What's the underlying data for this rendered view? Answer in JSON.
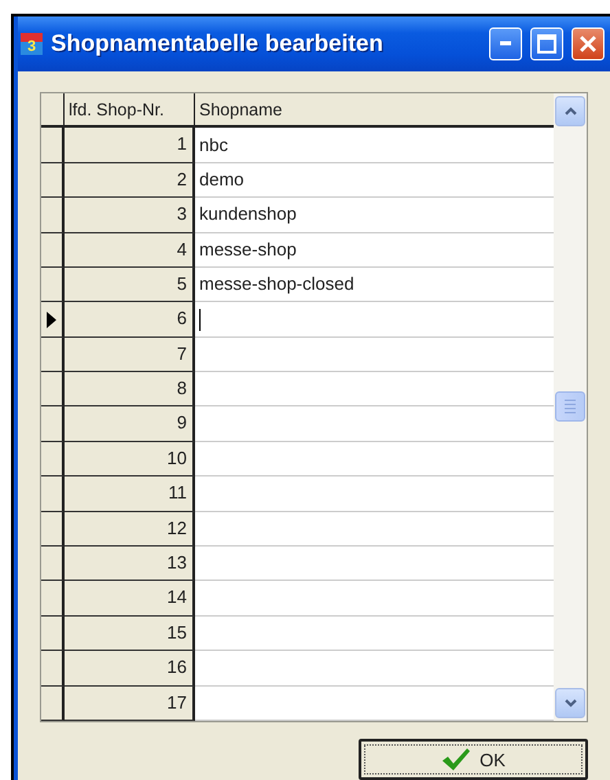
{
  "window": {
    "title": "Shopnamentabelle bearbeiten",
    "app_icon": "3"
  },
  "table": {
    "columns": [
      "lfd. Shop-Nr.",
      "Shopname"
    ],
    "rows": [
      {
        "number": "1",
        "name": "nbc",
        "selected": false
      },
      {
        "number": "2",
        "name": "demo",
        "selected": false
      },
      {
        "number": "3",
        "name": "kundenshop",
        "selected": false
      },
      {
        "number": "4",
        "name": "messe-shop",
        "selected": false
      },
      {
        "number": "5",
        "name": "messe-shop-closed",
        "selected": false
      },
      {
        "number": "6",
        "selected": true
      },
      {
        "number": "7",
        "selected": false
      },
      {
        "number": "8",
        "selected": false
      },
      {
        "number": "9",
        "selected": false
      },
      {
        "number": "10",
        "selected": false
      },
      {
        "number": "11",
        "selected": false
      },
      {
        "number": "12",
        "selected": false
      },
      {
        "number": "13",
        "selected": false
      },
      {
        "number": "14",
        "selected": false
      },
      {
        "number": "15",
        "selected": false
      },
      {
        "number": "16",
        "selected": false
      },
      {
        "number": "17",
        "selected": false
      }
    ]
  },
  "buttons": [
    {
      "label": "OK"
    }
  ]
}
